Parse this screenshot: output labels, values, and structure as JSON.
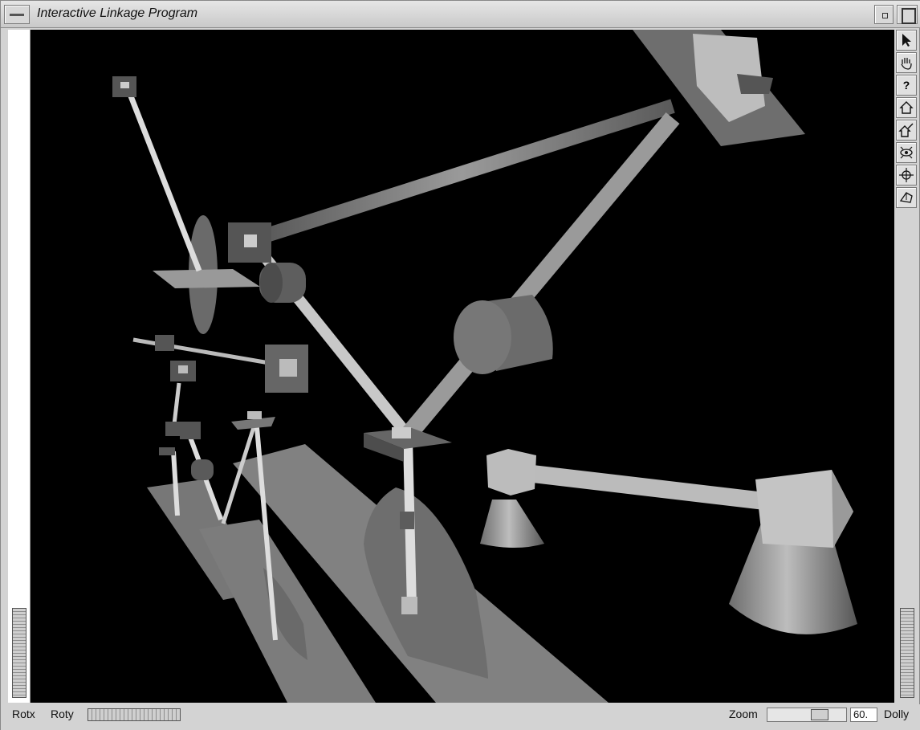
{
  "window": {
    "title": "Interactive Linkage Program"
  },
  "toolbar": {
    "buttons": [
      {
        "icon": "pointer-arrow-icon"
      },
      {
        "icon": "hand-icon"
      },
      {
        "icon": "help-icon",
        "label": "?"
      },
      {
        "icon": "home-icon"
      },
      {
        "icon": "set-home-icon"
      },
      {
        "icon": "view-all-icon"
      },
      {
        "icon": "seek-icon"
      },
      {
        "icon": "projection-icon"
      }
    ]
  },
  "bottom_bar": {
    "rotx_label": "Rotx",
    "roty_label": "Roty",
    "zoom_label": "Zoom",
    "zoom_value": "60.",
    "dolly_label": "Dolly"
  },
  "colors": {
    "viewer_background": "#000000",
    "chrome": "#d3d3d3"
  }
}
